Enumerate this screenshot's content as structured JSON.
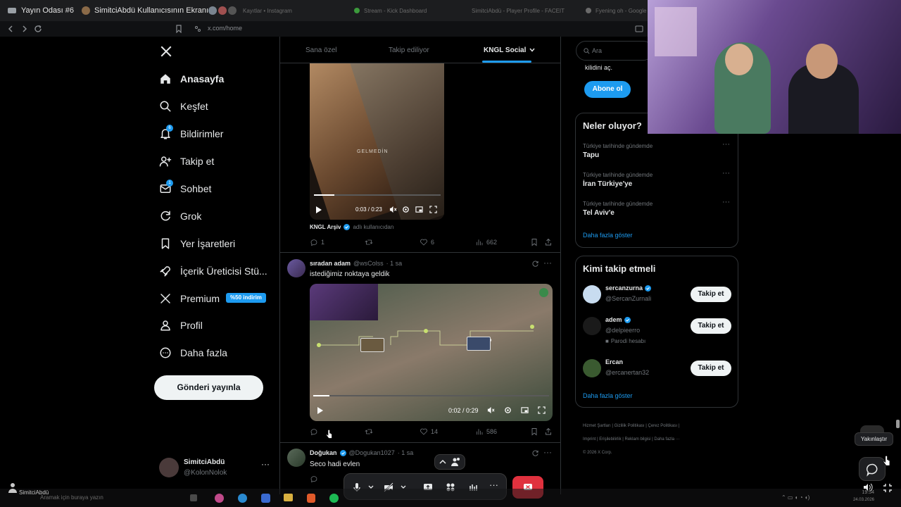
{
  "share_bar": {
    "room_title": "Yayın Odası #6",
    "screen_title": "SimitciAbdü Kullanıcısının Ekranı",
    "tabs": [
      "Kayıtlar • Instagram",
      "Stream - Kick Dashboard",
      "SimitciAbdü - Player Profile - FACEIT",
      "Fyening oh - Google"
    ]
  },
  "browser": {
    "url": "x.com/home"
  },
  "nav": {
    "items": [
      {
        "label": "Anasayfa",
        "icon": "home-icon",
        "badge": ""
      },
      {
        "label": "Keşfet",
        "icon": "search-icon",
        "badge": ""
      },
      {
        "label": "Bildirimler",
        "icon": "bell-icon",
        "badge": "6"
      },
      {
        "label": "Takip et",
        "icon": "add-user-icon",
        "badge": ""
      },
      {
        "label": "Sohbet",
        "icon": "mail-icon",
        "badge": "1"
      },
      {
        "label": "Grok",
        "icon": "grok-icon",
        "badge": ""
      },
      {
        "label": "Yer İşaretleri",
        "icon": "bookmark-icon",
        "badge": ""
      },
      {
        "label": "İçerik Üreticisi Stü...",
        "icon": "rocket-icon",
        "badge": ""
      },
      {
        "label": "Premium",
        "icon": "x-logo-icon",
        "badge": ""
      },
      {
        "label": "Profil",
        "icon": "person-icon",
        "badge": ""
      },
      {
        "label": "Daha fazla",
        "icon": "more-circle-icon",
        "badge": ""
      }
    ],
    "premium_badge": "%50 indirim",
    "post_button": "Gönderi yayınla"
  },
  "account": {
    "name": "SimitciAbdü",
    "handle": "@KolonNolok"
  },
  "feed": {
    "tabs": [
      "Sana özel",
      "Takip ediliyor",
      "KNGL Social"
    ],
    "active_tab": 2,
    "post1": {
      "video_time": "0:03 / 0:23",
      "video_overlay": "GELMEDİN",
      "source_name": "KNGL Arşiv",
      "source_suffix": "adlı kullanıcıdan",
      "replies": "1",
      "likes": "6",
      "views": "662"
    },
    "post2": {
      "name": "sıradan adam",
      "handle": "@wsColss",
      "time": "· 1 sa",
      "text": "istediğimiz noktaya geldik",
      "video_time": "0:02 / 0:29",
      "likes": "14",
      "views": "586"
    },
    "post3": {
      "name": "Doğukan",
      "handle": "@Dogukan1027",
      "time": "· 1 sa",
      "text": "Seco hadi evlen"
    }
  },
  "right": {
    "search_placeholder": "Ara",
    "subscribe_text": "kilidini aç.",
    "subscribe_button": "Abone ol",
    "trends_title": "Neler oluyor?",
    "trends": [
      {
        "context": "Türkiye tarihinde gündemde",
        "title": "Tapu"
      },
      {
        "context": "Türkiye tarihinde gündemde",
        "title": "İran Türkiye'ye"
      },
      {
        "context": "Türkiye tarihinde gündemde",
        "title": "Tel Aviv'e"
      }
    ],
    "show_more": "Daha fazla göster",
    "who_title": "Kimi takip etmeli",
    "who": [
      {
        "name": "sercanzurna",
        "handle": "@SercanZurnali",
        "note": "",
        "button": "Takip et"
      },
      {
        "name": "adem",
        "handle": "@delpieerro",
        "note": "Parodi hesabı",
        "button": "Takip et"
      },
      {
        "name": "Ercan",
        "handle": "@ercanertan32",
        "note": "",
        "button": "Takip et"
      }
    ],
    "who_more": "Daha fazla göster",
    "footer": [
      "Hizmet Şartları",
      "Gizlilik Politikası",
      "Çerez Politikası",
      "Imprint",
      "Erişilebilirlik",
      "Reklam bilgisi",
      "Daha fazla ···",
      "© 2026 X Corp."
    ]
  },
  "overlay": {
    "tooltip": "Yakınlaştır",
    "presenter": "SimitciAbdü",
    "taskbar_search": "Aramak için buraya yazın",
    "clock_time": "19:54",
    "clock_date": "24.03.2026"
  },
  "colors": {
    "accent": "#1d9bf0",
    "end_call": "#e0313e",
    "premium": "#1d9bf0"
  }
}
